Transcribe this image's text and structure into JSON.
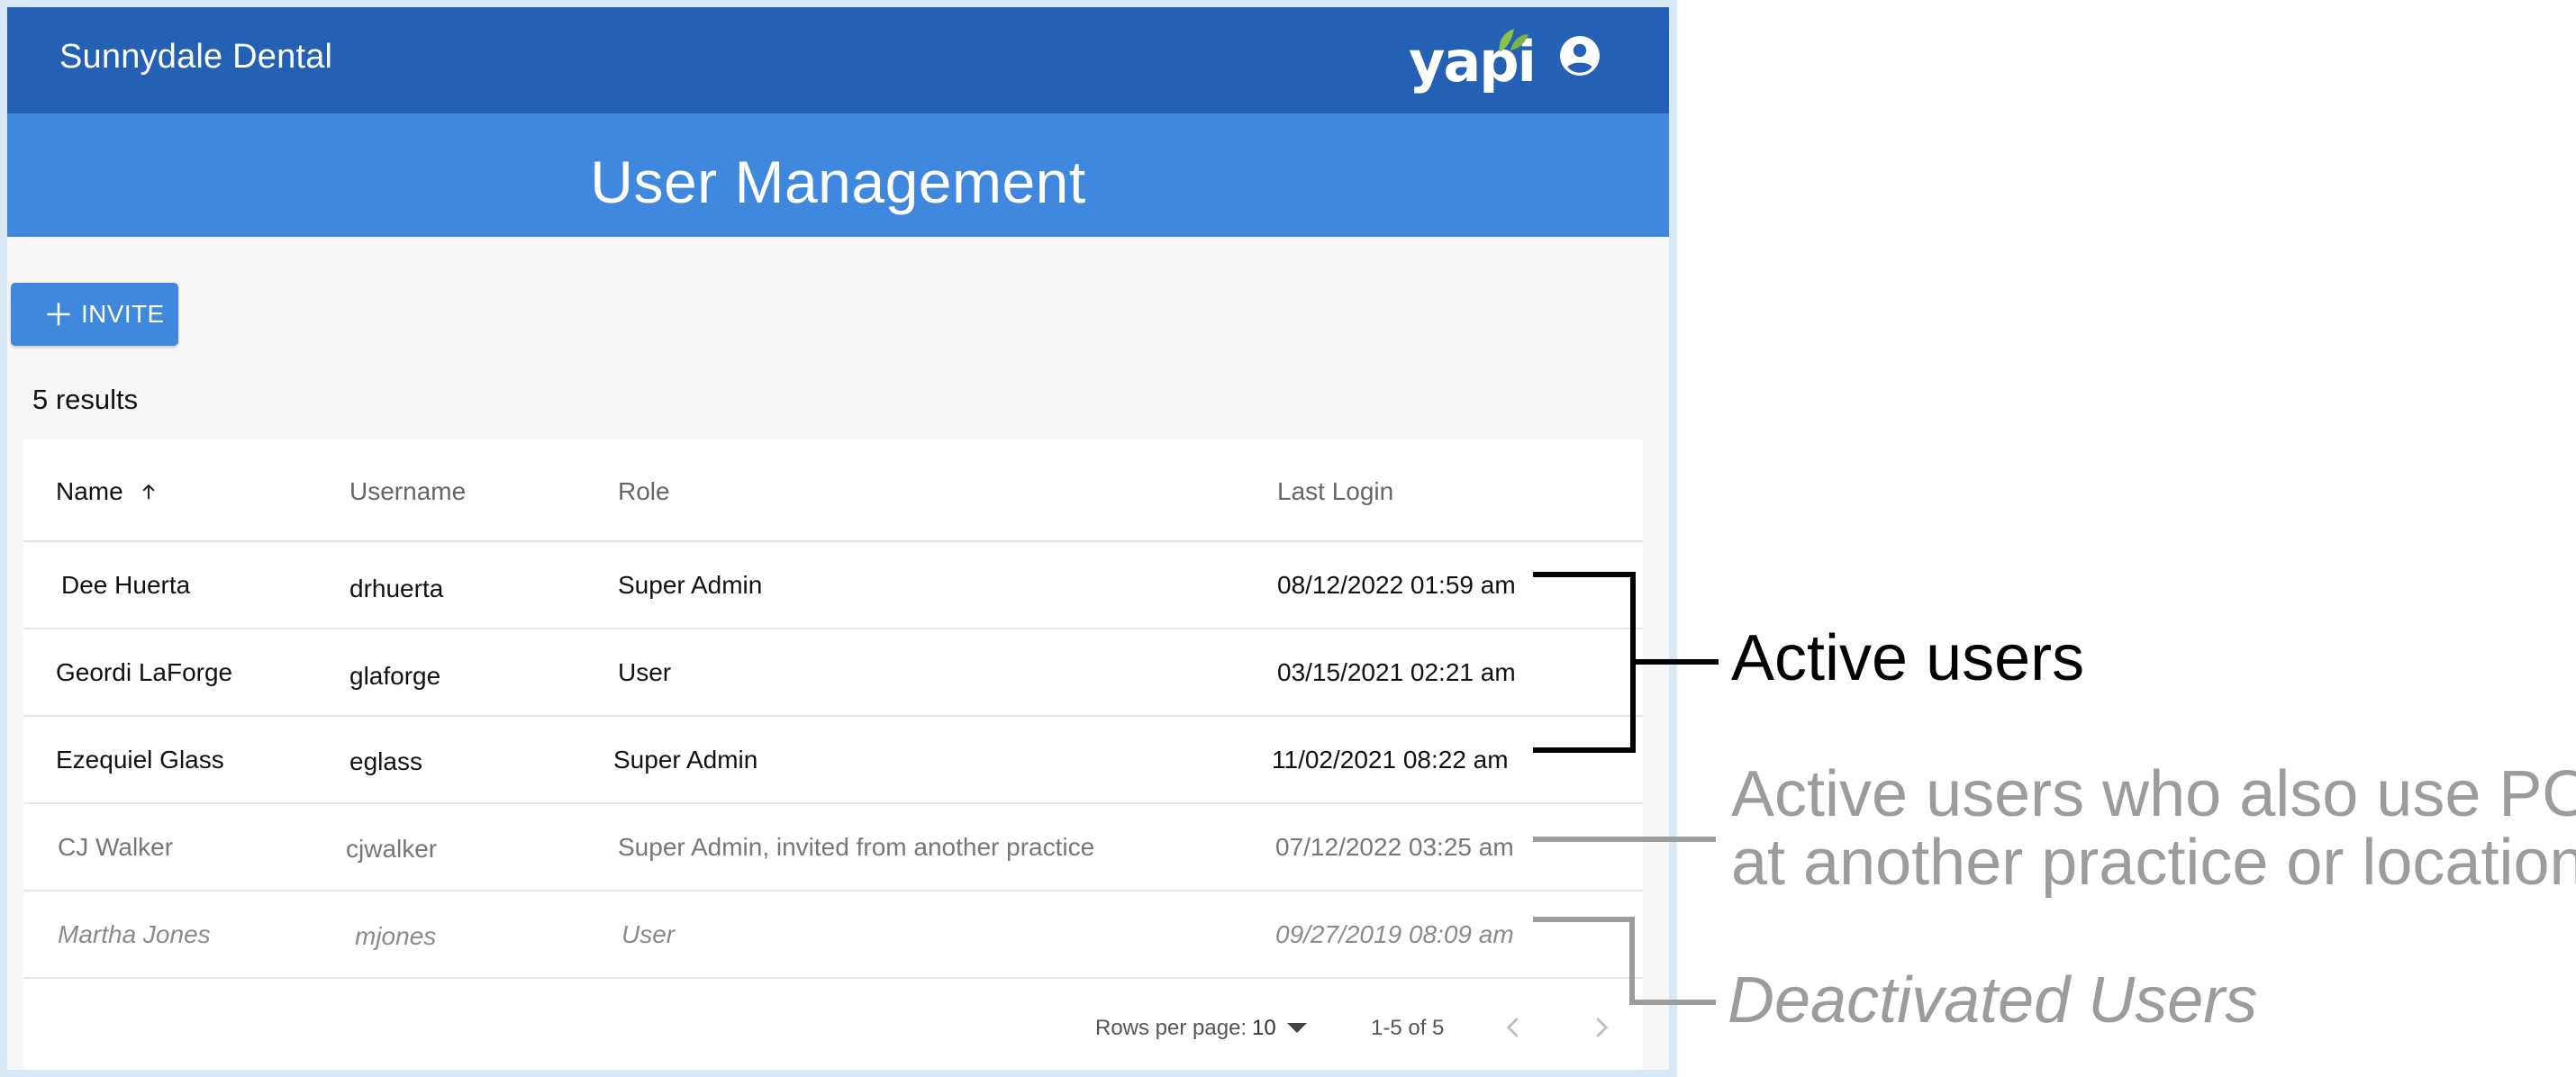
{
  "header": {
    "practice_name": "Sunnydale Dental",
    "logo_text": "yapi",
    "logo_icon": "leaf-logo-icon",
    "account_icon": "account-circle-icon",
    "page_title": "User Management"
  },
  "toolbar": {
    "invite_label": "INVITE",
    "invite_icon": "plus-icon"
  },
  "results": {
    "count_text": "5 results"
  },
  "table": {
    "columns": {
      "name": "Name",
      "username": "Username",
      "role": "Role",
      "last_login": "Last Login"
    },
    "sort_icon": "arrow-up-icon",
    "rows": [
      {
        "name": "Dee Huerta",
        "username": "drhuerta",
        "role": "Super Admin",
        "last_login": "08/12/2022 01:59 am",
        "status": "active"
      },
      {
        "name": "Geordi LaForge",
        "username": "glaforge",
        "role": "User",
        "last_login": "03/15/2021 02:21 am",
        "status": "active"
      },
      {
        "name": "Ezequiel Glass",
        "username": "eglass",
        "role": "Super Admin",
        "last_login": "11/02/2021 08:22 am",
        "status": "active"
      },
      {
        "name": "CJ Walker",
        "username": "cjwalker",
        "role": "Super Admin, invited from another practice",
        "last_login": "07/12/2022 03:25 am",
        "status": "invited"
      },
      {
        "name": "Martha Jones",
        "username": "mjones",
        "role": "User",
        "last_login": "09/27/2019 08:09 am",
        "status": "deactivated"
      }
    ],
    "pagination": {
      "rows_per_page_label": "Rows per page:",
      "rows_per_page_value": "10",
      "range_text": "1-5 of 5"
    }
  },
  "annotations": {
    "active": "Active users",
    "pop_line1": "Active users who also use POP",
    "pop_line2": "at another practice or location",
    "deactivated": "Deactivated Users"
  },
  "colors": {
    "topbar": "#2460b4",
    "titlebar": "#3f88de",
    "button": "#3f88de",
    "annotation_gray": "#9c9c9c"
  }
}
